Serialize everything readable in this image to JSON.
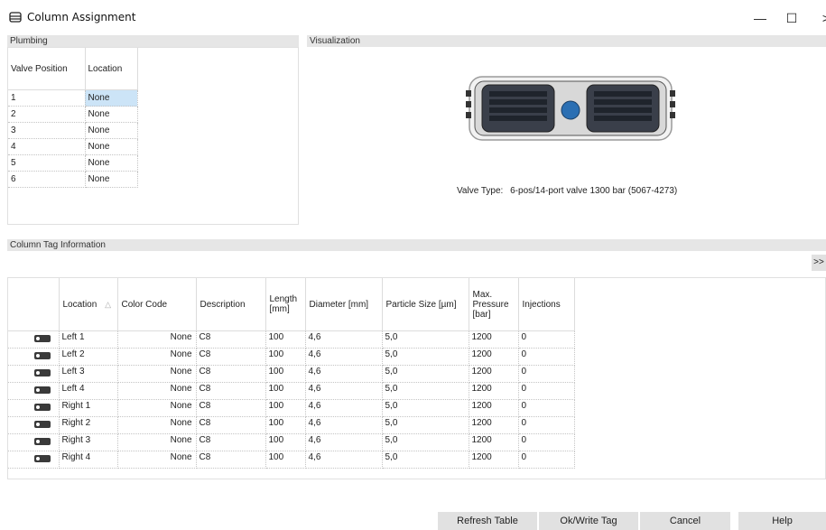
{
  "window": {
    "title": "Column Assignment",
    "minimize": "—",
    "maximize": "☐",
    "close": ">"
  },
  "plumbing": {
    "header": "Plumbing",
    "columns": [
      "Valve Position",
      "Location"
    ],
    "rows": [
      {
        "pos": "1",
        "loc": "None"
      },
      {
        "pos": "2",
        "loc": "None"
      },
      {
        "pos": "3",
        "loc": "None"
      },
      {
        "pos": "4",
        "loc": "None"
      },
      {
        "pos": "5",
        "loc": "None"
      },
      {
        "pos": "6",
        "loc": "None"
      }
    ]
  },
  "visualization": {
    "header": "Visualization",
    "valve_type_label": "Valve Type:",
    "valve_type_value": "6-pos/14-port valve 1300 bar (5067-4273)"
  },
  "tag_info": {
    "header": "Column Tag Information",
    "expand_button": ">>",
    "columns": [
      "Location",
      "Color Code",
      "Description",
      "Length [mm]",
      "Diameter [mm]",
      "Particle Size [µm]",
      "Max. Pressure [bar]",
      "Injections"
    ],
    "sort_indicator": "△",
    "rows": [
      {
        "location": "Left 1",
        "color": "None",
        "description": "C8",
        "length": "100",
        "diameter": "4,6",
        "particle": "5,0",
        "pressure": "1200",
        "injections": "0"
      },
      {
        "location": "Left 2",
        "color": "None",
        "description": "C8",
        "length": "100",
        "diameter": "4,6",
        "particle": "5,0",
        "pressure": "1200",
        "injections": "0"
      },
      {
        "location": "Left 3",
        "color": "None",
        "description": "C8",
        "length": "100",
        "diameter": "4,6",
        "particle": "5,0",
        "pressure": "1200",
        "injections": "0"
      },
      {
        "location": "Left 4",
        "color": "None",
        "description": "C8",
        "length": "100",
        "diameter": "4,6",
        "particle": "5,0",
        "pressure": "1200",
        "injections": "0"
      },
      {
        "location": "Right 1",
        "color": "None",
        "description": "C8",
        "length": "100",
        "diameter": "4,6",
        "particle": "5,0",
        "pressure": "1200",
        "injections": "0"
      },
      {
        "location": "Right 2",
        "color": "None",
        "description": "C8",
        "length": "100",
        "diameter": "4,6",
        "particle": "5,0",
        "pressure": "1200",
        "injections": "0"
      },
      {
        "location": "Right 3",
        "color": "None",
        "description": "C8",
        "length": "100",
        "diameter": "4,6",
        "particle": "5,0",
        "pressure": "1200",
        "injections": "0"
      },
      {
        "location": "Right 4",
        "color": "None",
        "description": "C8",
        "length": "100",
        "diameter": "4,6",
        "particle": "5,0",
        "pressure": "1200",
        "injections": "0"
      }
    ]
  },
  "buttons": {
    "refresh": "Refresh Table",
    "ok_write": "Ok/Write Tag",
    "cancel": "Cancel",
    "help": "Help"
  }
}
